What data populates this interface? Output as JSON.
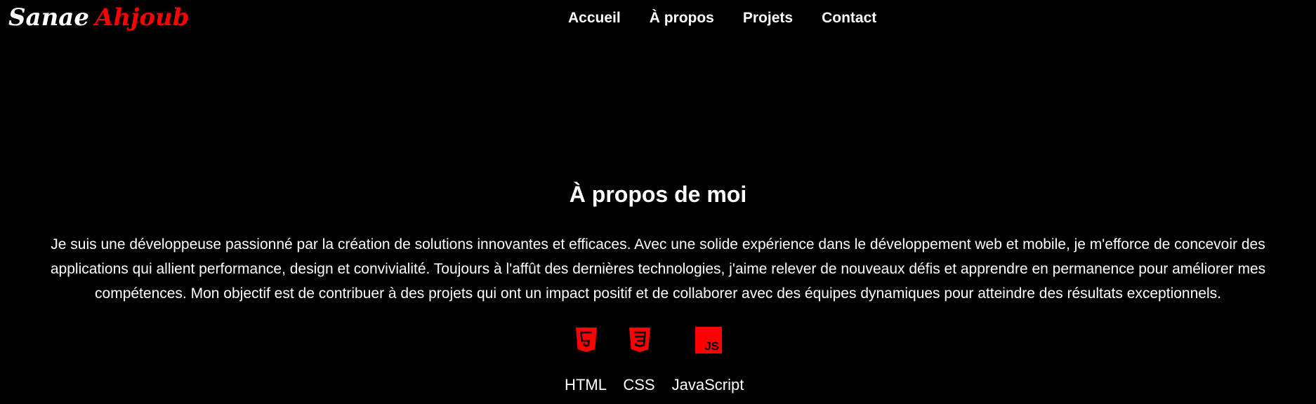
{
  "logo": {
    "first": "Sanae",
    "last": "Ahjoub"
  },
  "nav": {
    "items": [
      "Accueil",
      "À propos",
      "Projets",
      "Contact"
    ]
  },
  "about": {
    "title": "À propos de moi",
    "text": "Je suis une développeuse passionné par la création de solutions innovantes et efficaces. Avec une solide expérience dans le développement web et mobile, je m'efforce de concevoir des applications qui allient performance, design et convivialité. Toujours à l'affût des dernières technologies, j'aime relever de nouveaux défis et apprendre en permanence pour améliorer mes compétences. Mon objectif est de contribuer à des projets qui ont un impact positif et de collaborer avec des équipes dynamiques pour atteindre des résultats exceptionnels."
  },
  "skills": [
    {
      "label": "HTML",
      "icon": "html5-icon"
    },
    {
      "label": "CSS",
      "icon": "css3-icon"
    },
    {
      "label": "JavaScript",
      "icon": "javascript-icon"
    }
  ],
  "colors": {
    "background": "#000000",
    "accent": "#ff0000",
    "text": "#ffffff"
  }
}
